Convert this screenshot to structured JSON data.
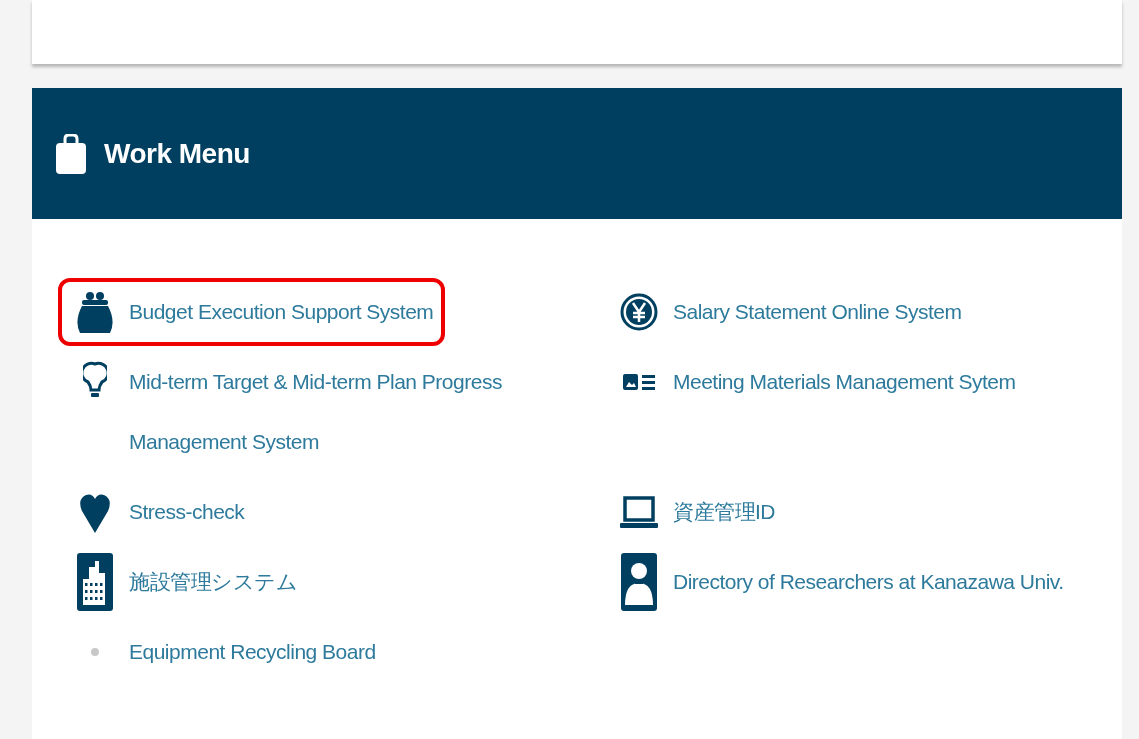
{
  "panel": {
    "title": "Work Menu"
  },
  "columns": [
    [
      {
        "label": "Budget Execution Support System",
        "highlighted": true
      },
      {
        "label": "Mid-term Target & Mid-term Plan Progress Management System",
        "highlighted": false
      },
      {
        "label": "Stress-check",
        "highlighted": false
      },
      {
        "label": "施設管理システム",
        "highlighted": false
      },
      {
        "label": "Equipment Recycling Board",
        "highlighted": false
      }
    ],
    [
      {
        "label": "Salary Statement Online System",
        "highlighted": false
      },
      {
        "label": "Meeting Materials Management Sytem",
        "highlighted": false
      },
      {
        "label": "資産管理ID",
        "highlighted": false
      },
      {
        "label": "Directory of Researchers at Kanazawa Univ.",
        "highlighted": false
      }
    ]
  ]
}
